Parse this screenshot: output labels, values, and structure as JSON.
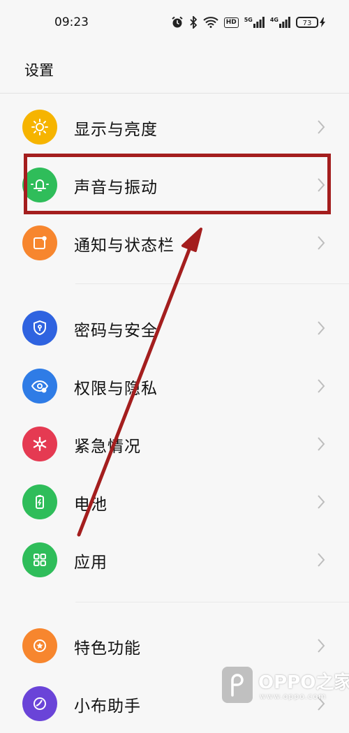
{
  "status_bar": {
    "time": "09:23",
    "network_5g": "5G",
    "network_4g": "4G",
    "hd_badge": "HD",
    "battery": "73"
  },
  "page": {
    "title": "设置"
  },
  "settings": [
    {
      "label": "显示与亮度",
      "icon": "sun-icon",
      "color": "#f6b400"
    },
    {
      "label": "声音与振动",
      "icon": "bell-icon",
      "color": "#2fbd5a"
    },
    {
      "label": "通知与状态栏",
      "icon": "notification-icon",
      "color": "#f7862e"
    },
    {
      "label": "密码与安全",
      "icon": "shield-icon",
      "color": "#2f63e0"
    },
    {
      "label": "权限与隐私",
      "icon": "privacy-eye-icon",
      "color": "#2f7ce6"
    },
    {
      "label": "紧急情况",
      "icon": "emergency-icon",
      "color": "#e53a52"
    },
    {
      "label": "电池",
      "icon": "battery-icon",
      "color": "#2fbd5a"
    },
    {
      "label": "应用",
      "icon": "apps-grid-icon",
      "color": "#2fbd5a"
    },
    {
      "label": "特色功能",
      "icon": "star-icon",
      "color": "#f7862e"
    },
    {
      "label": "小布助手",
      "icon": "assistant-icon",
      "color": "#6a44d8"
    }
  ],
  "annotation": {
    "highlight_color": "#a41e1e",
    "highlighted_item": "声音与振动"
  },
  "watermark": {
    "brand": "OPPO之家",
    "url": "www.oppo.com"
  }
}
